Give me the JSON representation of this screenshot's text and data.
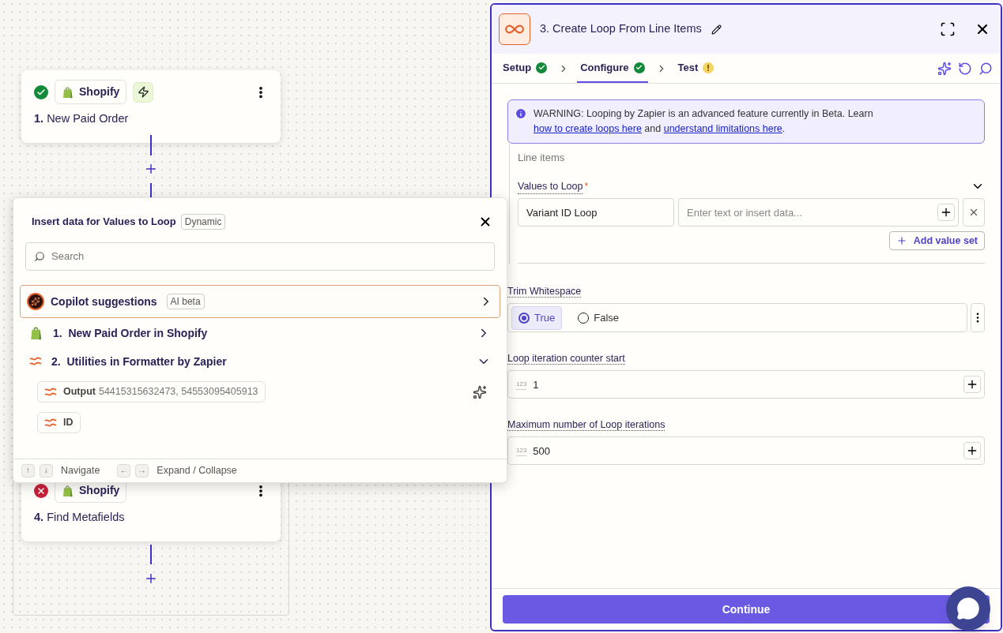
{
  "canvas": {
    "nodes": [
      {
        "failed": false,
        "app": "Shopify",
        "trigger": true,
        "number": "1.",
        "title": "New Paid Order"
      },
      {
        "failed": true,
        "app": "Shopify",
        "trigger": false,
        "number": "4.",
        "title": "Find Metafields"
      }
    ]
  },
  "popup": {
    "title": "Insert data for Values to Loop",
    "badge": "Dynamic",
    "search": {
      "placeholder": "Search"
    },
    "copilot": {
      "label": "Copilot suggestions",
      "badge": "AI beta"
    },
    "sources": [
      {
        "kind": "shopify",
        "number": "1.",
        "label": "New Paid Order in Shopify",
        "expanded": false
      },
      {
        "kind": "formatter",
        "number": "2.",
        "label": "Utilities in Formatter by Zapier",
        "expanded": true,
        "fields": [
          {
            "label": "Output",
            "value": "54415315632473, 54553095405913"
          },
          {
            "label": "ID"
          }
        ]
      }
    ],
    "hints": [
      {
        "keys": [
          "↑",
          "↓"
        ],
        "label": "Navigate"
      },
      {
        "keys": [
          "←",
          "→"
        ],
        "label": "Expand / Collapse"
      }
    ]
  },
  "panel": {
    "title": "3. Create Loop From Line Items",
    "tabs": [
      {
        "label": "Setup",
        "complete": true,
        "selected": false
      },
      {
        "label": "Configure",
        "complete": true,
        "selected": true
      },
      {
        "label": "Test",
        "complete": false,
        "selected": false
      }
    ],
    "warning": [
      {
        "kind": "text",
        "text": "WARNING: Looping by Zapier is an advanced feature currently in Beta. Learn "
      },
      {
        "kind": "link",
        "text": "how to create loops here"
      },
      {
        "kind": "text",
        "text": " and "
      },
      {
        "kind": "link",
        "text": "understand limitations here"
      },
      {
        "kind": "text",
        "text": "."
      }
    ],
    "section": "Line items",
    "values": {
      "label": "Values to Loop",
      "required_mark": "*",
      "key": "Variant ID Loop",
      "placeholder": "Enter text or insert data...",
      "add": "Add value set"
    },
    "trim": {
      "label": "Trim Whitespace",
      "options": [
        {
          "label": "True",
          "selected": true
        },
        {
          "label": "False",
          "selected": false
        }
      ]
    },
    "numbers": [
      {
        "label": "Loop iteration counter start",
        "hint": "123",
        "value": "1"
      },
      {
        "label": "Maximum number of Loop iterations",
        "hint": "123",
        "value": "500"
      }
    ],
    "continue": "Continue"
  }
}
